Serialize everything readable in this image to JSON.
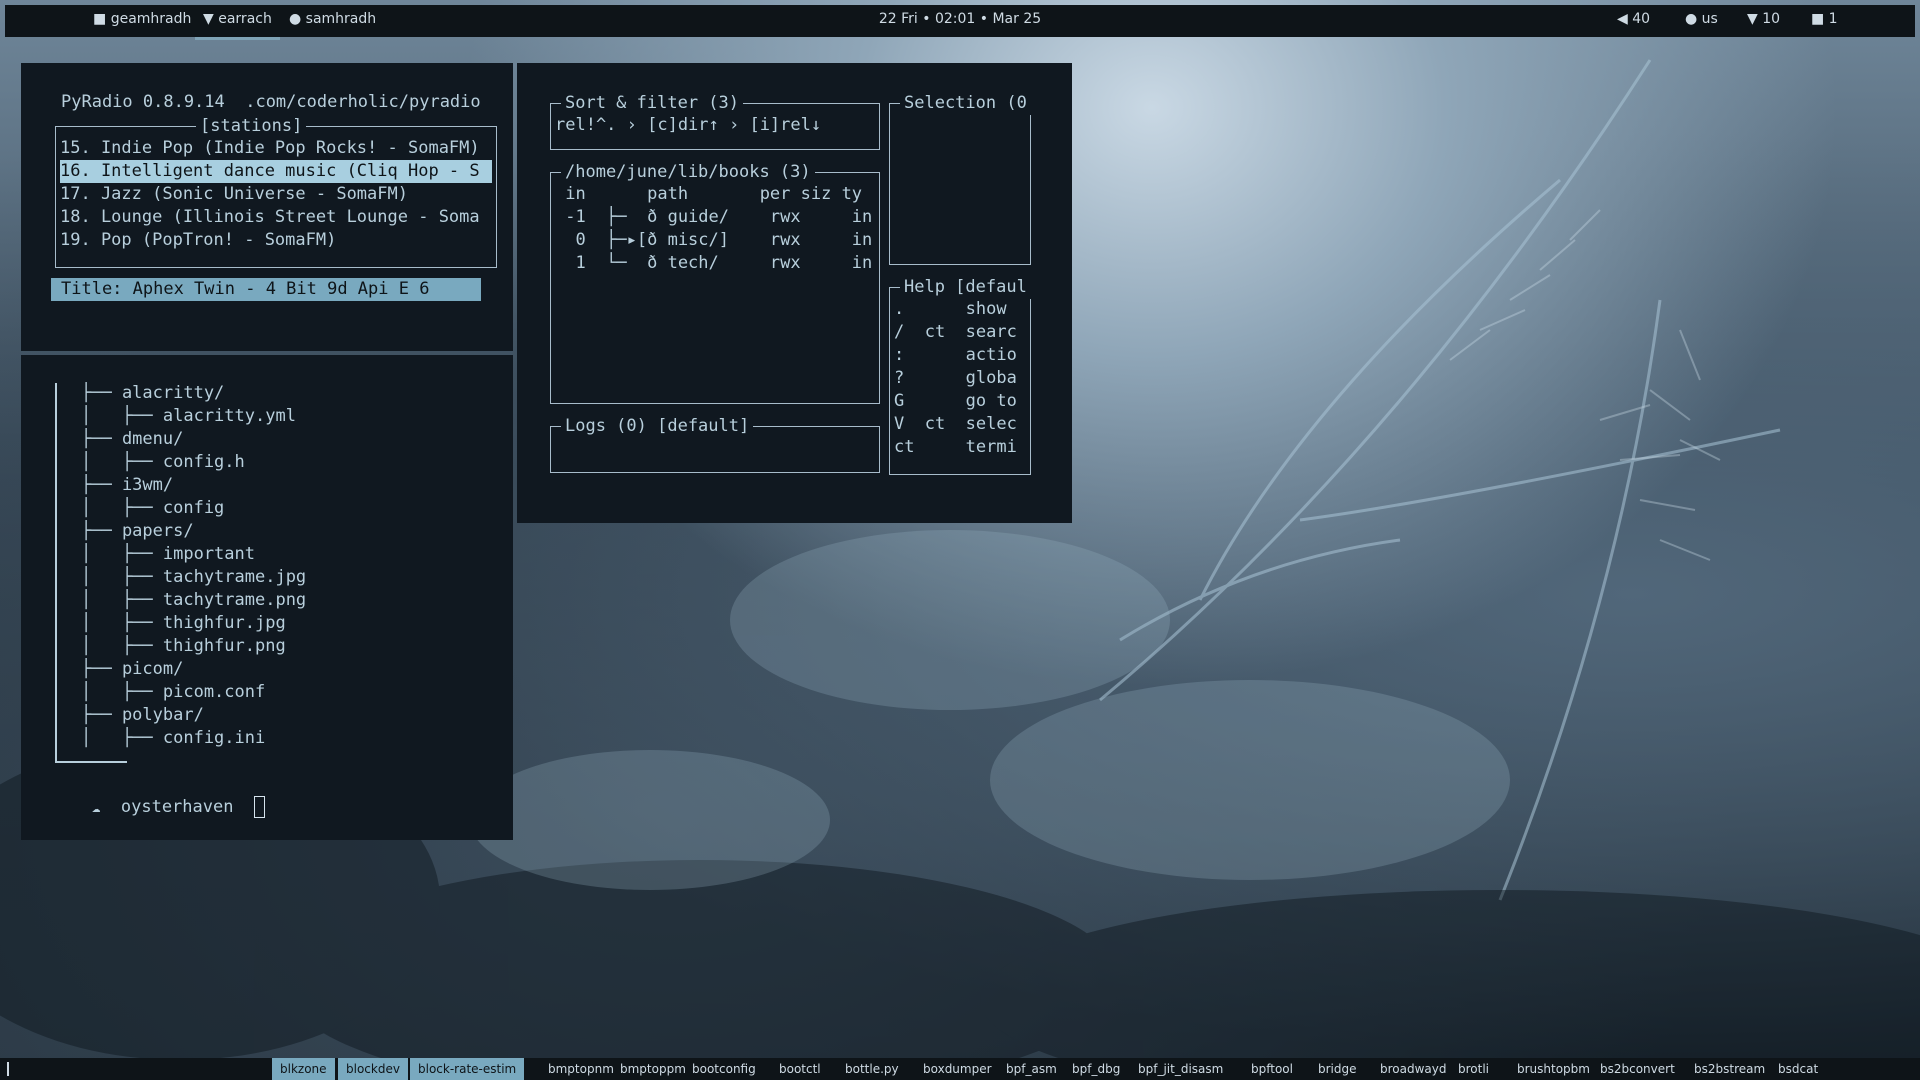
{
  "topbar": {
    "workspaces": [
      {
        "icon": "■",
        "label": "geamhradh"
      },
      {
        "icon": "▼",
        "label": "earrach"
      },
      {
        "icon": "●",
        "label": "samhradh"
      }
    ],
    "clock": "22 Fri • 02:01 • Mar 25",
    "status": {
      "volume": "◀ 40",
      "layout": "● us",
      "wifi": "▼ 10",
      "other": "■ 1"
    }
  },
  "pyradio": {
    "header": "PyRadio 0.8.9.14  .com/coderholic/pyradio",
    "stations_title": "[stations]",
    "stations": [
      "15. Indie Pop (Indie Pop Rocks! - SomaFM)",
      "16. Intelligent dance music (Cliq Hop - S",
      "17. Jazz (Sonic Universe - SomaFM)",
      "18. Lounge (Illinois Street Lounge - Soma",
      "19. Pop (PopTron! - SomaFM)"
    ],
    "now_playing": "Title: Aphex Twin - 4 Bit 9d Api E 6"
  },
  "tree": {
    "lines": [
      "├── alacritty/",
      "│   ├── alacritty.yml",
      "├── dmenu/",
      "│   ├── config.h",
      "├── i3wm/",
      "│   ├── config",
      "├── papers/",
      "│   ├── important",
      "│   ├── tachytrame.jpg",
      "│   ├── tachytrame.png",
      "│   ├── thighfur.jpg",
      "│   ├── thighfur.png",
      "├── picom/",
      "│   ├── picom.conf",
      "├── polybar/",
      "│   ├── config.ini"
    ],
    "prompt_host": "oysterhaven",
    "prompt_icon": "☁"
  },
  "filemanager": {
    "sort_title": "Sort & filter (3)",
    "sort_value": "rel!^. › [c]dir↑ › [i]rel↓",
    "selection_title": "Selection (0",
    "path_title": "/home/june/lib/books (3)",
    "table_header": " in      path       per siz ty",
    "rows": [
      " -1  ├─  ð guide/    rwx     in",
      "  0  ├─▸[ð misc/]    rwx     in",
      "  1  └─  ð tech/     rwx     in"
    ],
    "help_title": "Help [defaul",
    "help_lines": [
      ".      show",
      "/  ct  searc",
      ":      actio",
      "?      globa",
      "G      go to",
      "V  ct  selec",
      "ct     termi"
    ],
    "logs_title": "Logs (0) [default]"
  },
  "bottombar": {
    "items": [
      {
        "label": "blkzone",
        "selected": true
      },
      {
        "label": "blockdev",
        "selected": true
      },
      {
        "label": "block-rate-estim",
        "selected": true
      },
      {
        "label": "bmptopnm",
        "selected": false
      },
      {
        "label": "bmptoppm",
        "selected": false
      },
      {
        "label": "bootconfig",
        "selected": false
      },
      {
        "label": "bootctl",
        "selected": false
      },
      {
        "label": "bottle.py",
        "selected": false
      },
      {
        "label": "boxdumper",
        "selected": false
      },
      {
        "label": "bpf_asm",
        "selected": false
      },
      {
        "label": "bpf_dbg",
        "selected": false
      },
      {
        "label": "bpf_jit_disasm",
        "selected": false
      },
      {
        "label": "bpftool",
        "selected": false
      },
      {
        "label": "bridge",
        "selected": false
      },
      {
        "label": "broadwayd",
        "selected": false
      },
      {
        "label": "brotli",
        "selected": false
      },
      {
        "label": "brushtopbm",
        "selected": false
      },
      {
        "label": "bs2bconvert",
        "selected": false
      },
      {
        "label": "bs2bstream",
        "selected": false
      },
      {
        "label": "bsdcat",
        "selected": false
      }
    ]
  }
}
